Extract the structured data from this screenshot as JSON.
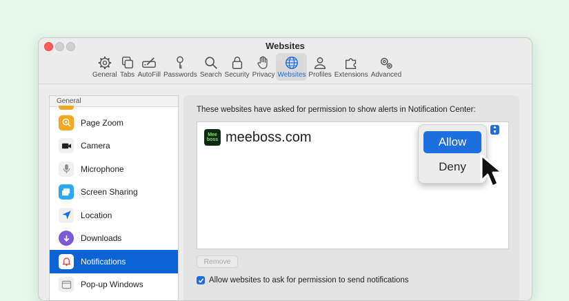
{
  "window": {
    "title": "Websites"
  },
  "toolbar": {
    "items": [
      {
        "label": "General",
        "icon": "gear-icon"
      },
      {
        "label": "Tabs",
        "icon": "tabs-icon"
      },
      {
        "label": "AutoFill",
        "icon": "autofill-icon"
      },
      {
        "label": "Passwords",
        "icon": "key-icon"
      },
      {
        "label": "Search",
        "icon": "magnifier-icon"
      },
      {
        "label": "Security",
        "icon": "lock-icon"
      },
      {
        "label": "Privacy",
        "icon": "hand-icon"
      },
      {
        "label": "Websites",
        "icon": "globe-icon",
        "active": true
      },
      {
        "label": "Profiles",
        "icon": "person-icon"
      },
      {
        "label": "Extensions",
        "icon": "puzzle-icon"
      },
      {
        "label": "Advanced",
        "icon": "gears-icon"
      }
    ]
  },
  "sidebar": {
    "header": "General",
    "items": [
      {
        "label": "Page Zoom",
        "icon": "zoom-icon",
        "color": "#f5a623"
      },
      {
        "label": "Camera",
        "icon": "camera-icon",
        "color": "#1f1f1f"
      },
      {
        "label": "Microphone",
        "icon": "microphone-icon",
        "color": "#8e8e8e"
      },
      {
        "label": "Screen Sharing",
        "icon": "screen-share-icon",
        "color": "#2aa8f2"
      },
      {
        "label": "Location",
        "icon": "location-icon",
        "color": "#1d6fe0"
      },
      {
        "label": "Downloads",
        "icon": "download-icon",
        "color": "#7b5cd6"
      },
      {
        "label": "Notifications",
        "icon": "bell-icon",
        "color": "#ffffff",
        "selected": true
      },
      {
        "label": "Pop-up Windows",
        "icon": "popup-window-icon",
        "color": "#8e8e8e"
      }
    ]
  },
  "panel": {
    "description": "These websites have asked for permission to show alerts in Notification Center:",
    "site": {
      "name": "meeboss.com",
      "logo_top": "Mee",
      "logo_bottom": "boss"
    },
    "popup": {
      "allow": "Allow",
      "deny": "Deny"
    },
    "remove_label": "Remove",
    "allow_checkbox_label": "Allow websites to ask for permission to send notifications"
  },
  "colors": {
    "accent": "#1d6fe0",
    "close": "#ff5f57",
    "background": "#e7f7ec"
  }
}
